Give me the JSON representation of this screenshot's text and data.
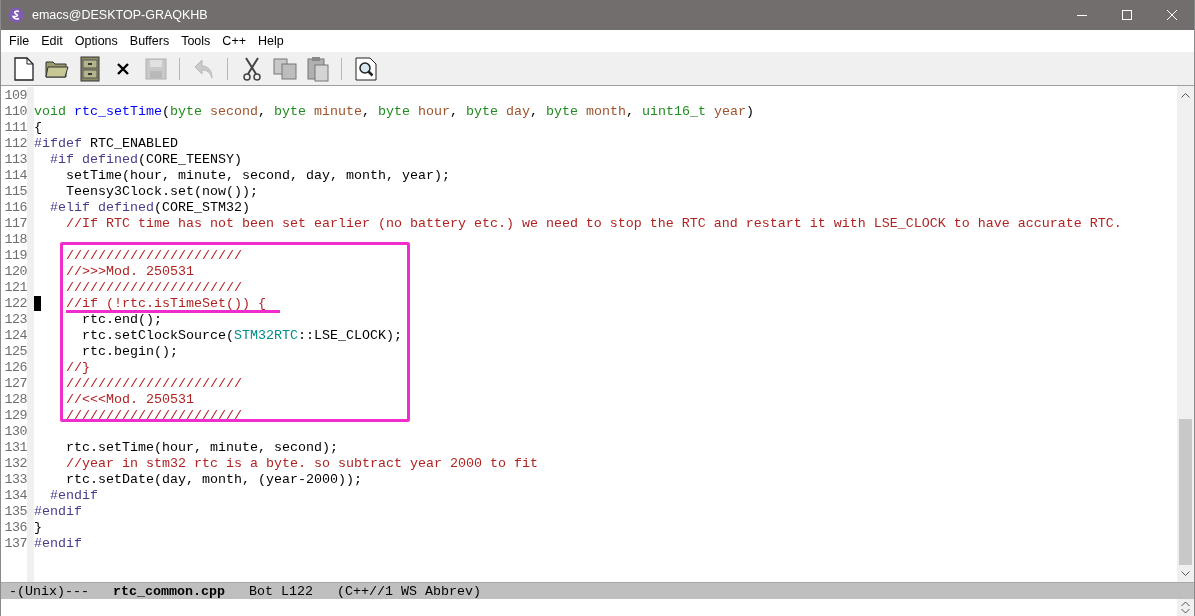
{
  "window": {
    "title": "emacs@DESKTOP-GRAQKHB"
  },
  "menu": [
    "File",
    "Edit",
    "Options",
    "Buffers",
    "Tools",
    "C++",
    "Help"
  ],
  "toolbar": [
    {
      "kind": "button",
      "disabled": false
    },
    {
      "kind": "button",
      "disabled": false
    },
    {
      "kind": "button",
      "disabled": false
    },
    {
      "kind": "button",
      "disabled": false
    },
    {
      "kind": "button",
      "disabled": true
    },
    {
      "kind": "separator"
    },
    {
      "kind": "button",
      "disabled": true
    },
    {
      "kind": "separator"
    },
    {
      "kind": "button",
      "disabled": false
    },
    {
      "kind": "button",
      "disabled": false
    },
    {
      "kind": "button",
      "disabled": false
    },
    {
      "kind": "separator"
    },
    {
      "kind": "button",
      "disabled": false
    }
  ],
  "code": [
    {
      "kind": "line",
      "number": "109"
    },
    {
      "kind": "line",
      "number": "110",
      "tokens": [
        {
          "kind": "type",
          "text": "void"
        },
        {
          "kind": "function",
          "text": " rtc_setTime"
        },
        {
          "kind": "plain",
          "text": "("
        },
        {
          "kind": "type",
          "text": "byte"
        },
        {
          "kind": "variable",
          "text": " second"
        },
        {
          "kind": "plain",
          "text": ", "
        },
        {
          "kind": "type",
          "text": "byte"
        },
        {
          "kind": "variable",
          "text": " minute"
        },
        {
          "kind": "plain",
          "text": ", "
        },
        {
          "kind": "type",
          "text": "byte"
        },
        {
          "kind": "variable",
          "text": " hour"
        },
        {
          "kind": "plain",
          "text": ", "
        },
        {
          "kind": "type",
          "text": "byte"
        },
        {
          "kind": "variable",
          "text": " day"
        },
        {
          "kind": "plain",
          "text": ", "
        },
        {
          "kind": "type",
          "text": "byte"
        },
        {
          "kind": "variable",
          "text": " month"
        },
        {
          "kind": "plain",
          "text": ", "
        },
        {
          "kind": "type",
          "text": "uint16_t"
        },
        {
          "kind": "variable",
          "text": " year"
        },
        {
          "kind": "plain",
          "text": ")"
        }
      ]
    },
    {
      "kind": "line",
      "number": "111",
      "tokens": [
        {
          "kind": "plain",
          "text": "{"
        }
      ]
    },
    {
      "kind": "line",
      "number": "112",
      "tokens": [
        {
          "kind": "preproc",
          "text": "#ifdef"
        },
        {
          "kind": "plain",
          "text": " RTC_ENABLED"
        }
      ]
    },
    {
      "kind": "line",
      "number": "113",
      "tokens": [
        {
          "kind": "preproc",
          "text": "  #if defined"
        },
        {
          "kind": "plain",
          "text": "(CORE_TEENSY)"
        }
      ]
    },
    {
      "kind": "line",
      "number": "114",
      "tokens": [
        {
          "kind": "plain",
          "text": "    setTime(hour, minute, second, day, month, year);"
        }
      ]
    },
    {
      "kind": "line",
      "number": "115",
      "tokens": [
        {
          "kind": "plain",
          "text": "    Teensy3Clock.set(now());"
        }
      ]
    },
    {
      "kind": "line",
      "number": "116",
      "tokens": [
        {
          "kind": "preproc",
          "text": "  #elif defined"
        },
        {
          "kind": "plain",
          "text": "(CORE_STM32)"
        }
      ]
    },
    {
      "kind": "line",
      "number": "117",
      "tokens": [
        {
          "kind": "comment",
          "text": "    //If RTC time has not been set earlier (no battery etc.) we need to stop the RTC and restart it with LSE_CLOCK to have accurate RTC."
        }
      ]
    },
    {
      "kind": "line",
      "number": "118"
    },
    {
      "kind": "frame",
      "lines": [
        {
          "kind": "line",
          "number": "119",
          "tokens": [
            {
              "kind": "comment",
              "text": "    //////////////////////"
            }
          ]
        },
        {
          "kind": "line",
          "number": "120",
          "tokens": [
            {
              "kind": "comment",
              "text": "    //>>>Mod. 250531"
            }
          ]
        },
        {
          "kind": "line",
          "number": "121",
          "tokens": [
            {
              "kind": "comment",
              "text": "    //////////////////////"
            }
          ]
        },
        {
          "kind": "line",
          "number": "122",
          "cursor": true,
          "tokens": [
            {
              "kind": "comment",
              "text": "    //if (!rtc.isTimeSet()) {",
              "underlined": true
            }
          ]
        },
        {
          "kind": "line",
          "number": "123",
          "tokens": [
            {
              "kind": "plain",
              "text": "      rtc.end();"
            }
          ]
        },
        {
          "kind": "line",
          "number": "124",
          "tokens": [
            {
              "kind": "plain",
              "text": "      rtc.setClockSource("
            },
            {
              "kind": "class",
              "text": "STM32RTC"
            },
            {
              "kind": "plain",
              "text": "::LSE_CLOCK);"
            }
          ]
        },
        {
          "kind": "line",
          "number": "125",
          "tokens": [
            {
              "kind": "plain",
              "text": "      rtc.begin();"
            }
          ]
        },
        {
          "kind": "line",
          "number": "126",
          "tokens": [
            {
              "kind": "comment",
              "text": "    //}"
            }
          ]
        },
        {
          "kind": "line",
          "number": "127",
          "tokens": [
            {
              "kind": "comment",
              "text": "    //////////////////////"
            }
          ]
        },
        {
          "kind": "line",
          "number": "128",
          "tokens": [
            {
              "kind": "comment",
              "text": "    //<<<Mod. 250531"
            }
          ]
        },
        {
          "kind": "line",
          "number": "129",
          "tokens": [
            {
              "kind": "comment",
              "text": "    //////////////////////"
            }
          ]
        }
      ]
    },
    {
      "kind": "line",
      "number": "130"
    },
    {
      "kind": "line",
      "number": "131",
      "tokens": [
        {
          "kind": "plain",
          "text": "    rtc.setTime(hour, minute, second);"
        }
      ]
    },
    {
      "kind": "line",
      "number": "132",
      "tokens": [
        {
          "kind": "comment",
          "text": "    //year in stm32 rtc is a byte. so subtract year 2000 to fit"
        }
      ]
    },
    {
      "kind": "line",
      "number": "133",
      "tokens": [
        {
          "kind": "plain",
          "text": "    rtc.setDate(day, month, (year-2000));"
        }
      ]
    },
    {
      "kind": "line",
      "number": "134",
      "tokens": [
        {
          "kind": "preproc",
          "text": "  #endif"
        }
      ]
    },
    {
      "kind": "line",
      "number": "135",
      "tokens": [
        {
          "kind": "preproc",
          "text": "#endif"
        }
      ]
    },
    {
      "kind": "line",
      "number": "136",
      "tokens": [
        {
          "kind": "plain",
          "text": "}"
        }
      ]
    },
    {
      "kind": "line",
      "number": "137",
      "tokens": [
        {
          "kind": "preproc",
          "text": "#endif"
        }
      ]
    }
  ],
  "mode_line": [
    {
      "kind": "plain",
      "text": "-(Unix)---"
    },
    {
      "kind": "buffer",
      "text": "rtc_common.cpp"
    },
    {
      "kind": "plain",
      "text": "Bot L122"
    },
    {
      "kind": "plain",
      "text": "(C++//1 WS Abbrev)"
    }
  ]
}
